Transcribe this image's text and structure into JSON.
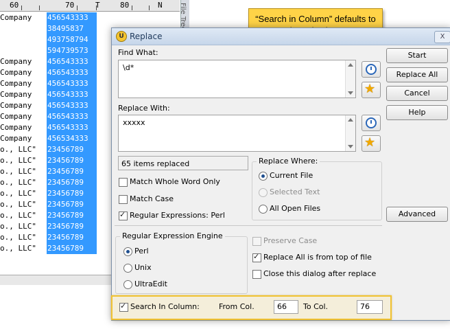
{
  "editor": {
    "ruler": {
      "marks": [
        "60",
        "70",
        "T",
        "80",
        "N"
      ]
    },
    "side_tab_label": "File Tree / History",
    "lines": [
      {
        "left": "Company",
        "selected": "456543333"
      },
      {
        "left": "",
        "selected": "38495837"
      },
      {
        "left": "",
        "selected": "493758794"
      },
      {
        "left": "",
        "selected": "594739573"
      },
      {
        "left": "Company",
        "selected": "456543333"
      },
      {
        "left": "Company",
        "selected": "456543333"
      },
      {
        "left": "Company",
        "selected": "456543333"
      },
      {
        "left": "Company",
        "selected": "456543333"
      },
      {
        "left": "Company",
        "selected": "456543333"
      },
      {
        "left": "Company",
        "selected": "456543333"
      },
      {
        "left": "Company",
        "selected": "456543333"
      },
      {
        "left": "Company",
        "selected": "456534333"
      },
      {
        "left": "o., LLC\"",
        "selected": "23456789"
      },
      {
        "left": "o., LLC\"",
        "selected": "23456789"
      },
      {
        "left": "o., LLC\"",
        "selected": "23456789"
      },
      {
        "left": "o., LLC\"",
        "selected": "23456789"
      },
      {
        "left": "o., LLC\"",
        "selected": "23456789"
      },
      {
        "left": "o., LLC\"",
        "selected": "23456789"
      },
      {
        "left": "o., LLC\"",
        "selected": "23456789"
      },
      {
        "left": "o., LLC\"",
        "selected": "23456789"
      },
      {
        "left": "o., LLC\"",
        "selected": "23456789"
      },
      {
        "left": "o., LLC\"",
        "selected": "23456789"
      }
    ]
  },
  "callout": {
    "text": "“Search in Column” defaults to your selected column range"
  },
  "dialog": {
    "title": "Replace",
    "app_icon_glyph": "U",
    "close_glyph": "X",
    "find_what_label": "Find What:",
    "find_what_value": "\\d*",
    "replace_with_label": "Replace With:",
    "replace_with_value": "xxxxx",
    "status_text": "65 items replaced",
    "buttons": {
      "start": "Start",
      "replace_all": "Replace All",
      "cancel": "Cancel",
      "help": "Help",
      "advanced": "Advanced"
    },
    "options": {
      "match_whole_word": {
        "label": "Match Whole Word Only",
        "checked": false
      },
      "match_case": {
        "label": "Match Case",
        "checked": false
      },
      "regex_perl": {
        "label": "Regular Expressions: Perl",
        "checked": true
      }
    },
    "replace_where": {
      "title": "Replace Where:",
      "current_file": "Current File",
      "selected_text": "Selected Text",
      "all_open_files": "All Open Files",
      "selected": "current_file"
    },
    "regex_engine": {
      "title": "Regular Expression Engine",
      "perl": "Perl",
      "unix": "Unix",
      "ultraedit": "UltraEdit",
      "selected": "perl"
    },
    "right_options": {
      "preserve_case": "Preserve Case",
      "replace_from_top": "Replace All is from top of file",
      "close_after": "Close this dialog after replace"
    },
    "search_in_column": {
      "label": "Search In Column:",
      "checked": true,
      "from_label": "From Col.",
      "from_value": "66",
      "to_label": "To Col.",
      "to_value": "76"
    }
  },
  "colors": {
    "selection": "#3399ff",
    "callout": "#ffd347",
    "highlight_border": "#f1c232"
  }
}
